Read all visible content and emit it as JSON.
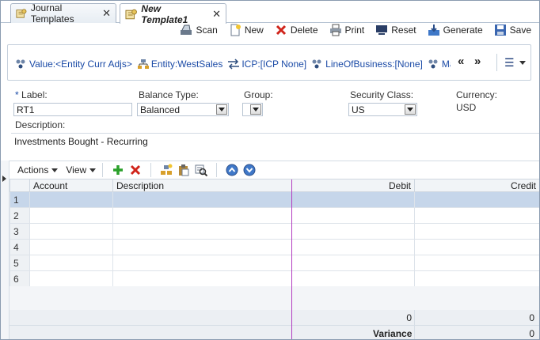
{
  "tabs": [
    {
      "label": "Journal Templates",
      "close": "✕"
    },
    {
      "label": "New Template1",
      "close": "✕"
    }
  ],
  "toolbar": {
    "scan": "Scan",
    "new": "New",
    "delete": "Delete",
    "print": "Print",
    "reset": "Reset",
    "generate": "Generate",
    "save": "Save"
  },
  "pov": {
    "items": [
      "Value:<Entity Curr Adjs>",
      "Entity:WestSales",
      "ICP:[ICP None]",
      "LineOfBusiness:[None]",
      "Markets"
    ],
    "prev": "«",
    "next": "»",
    "menu": "☰"
  },
  "form": {
    "label_caption": "Label:",
    "label_value": "RT1",
    "balance_caption": "Balance Type:",
    "balance_value": "Balanced",
    "group_caption": "Group:",
    "group_value": "",
    "security_caption": "Security Class:",
    "security_value": "US",
    "currency_caption": "Currency:",
    "currency_value": "USD",
    "description_caption": "Description:",
    "description_value": "Investments Bought - Recurring"
  },
  "grid_toolbar": {
    "actions": "Actions",
    "view": "View"
  },
  "table": {
    "columns": [
      "Account",
      "Description",
      "Debit",
      "Credit"
    ],
    "rows": [
      "1",
      "2",
      "3",
      "4",
      "5",
      "6"
    ],
    "total_debit": "0",
    "total_credit": "0",
    "variance_label": "Variance",
    "variance_value": "0"
  },
  "colors": {
    "accent": "#1a4aa6",
    "selected_row": "#c6d6ea",
    "splitter": "#b23cc0"
  }
}
